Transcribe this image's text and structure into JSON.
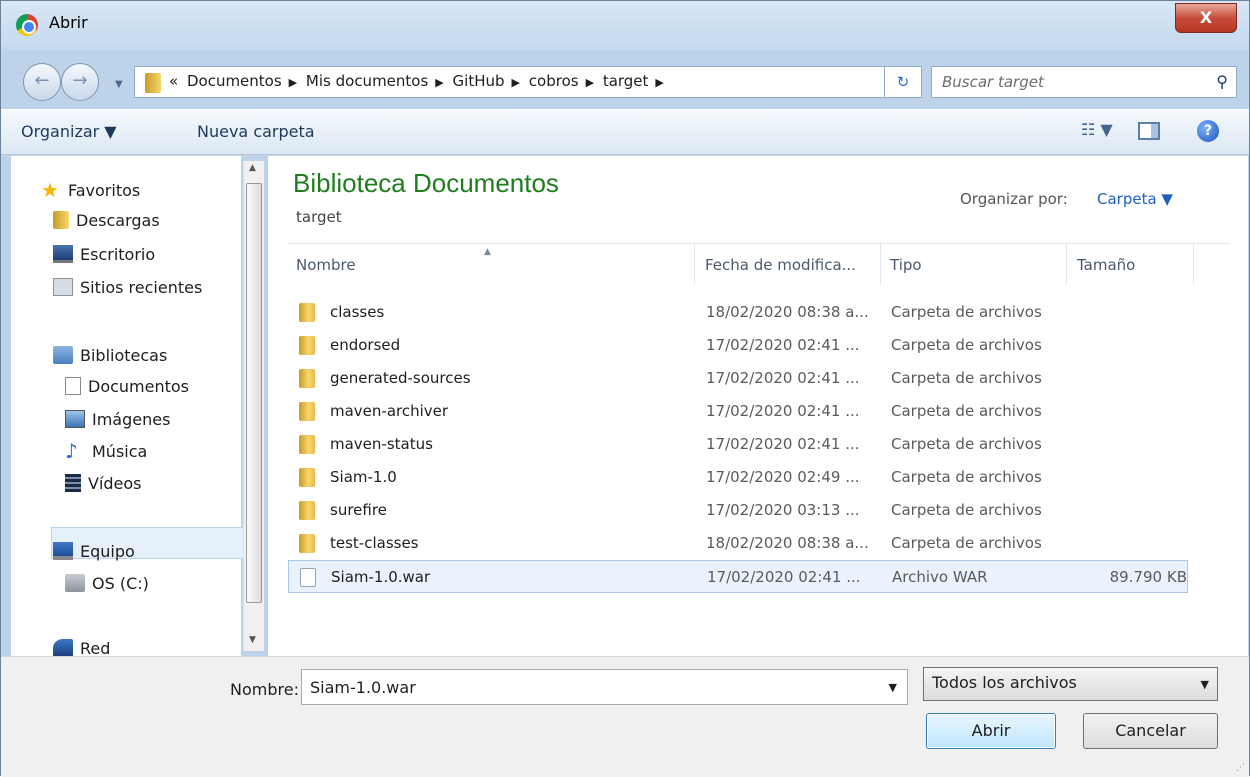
{
  "window": {
    "title": "Abrir",
    "close_label": "X"
  },
  "address": {
    "overflow": "«",
    "crumbs": [
      "Documentos",
      "Mis documentos",
      "GitHub",
      "cobros",
      "target"
    ],
    "separator": "▶",
    "search_placeholder": "Buscar target"
  },
  "toolbar": {
    "organize_label": "Organizar ▼",
    "new_folder_label": "Nueva carpeta",
    "views_label": "☷ ▼",
    "help_label": "?"
  },
  "sidebar": {
    "favorites": {
      "label": "Favoritos",
      "items": [
        "Descargas",
        "Escritorio",
        "Sitios recientes"
      ]
    },
    "libraries": {
      "label": "Bibliotecas",
      "items": [
        "Documentos",
        "Imágenes",
        "Música",
        "Vídeos"
      ]
    },
    "computer": {
      "label": "Equipo",
      "items": [
        "OS (C:)"
      ]
    },
    "network": {
      "label": "Red"
    },
    "selected": "Documentos"
  },
  "content": {
    "library_title": "Biblioteca Documentos",
    "library_subtitle": "target",
    "arrange_label": "Organizar por:",
    "arrange_value": "Carpeta ▼",
    "columns": {
      "name": "Nombre",
      "date": "Fecha de modifica...",
      "type": "Tipo",
      "size": "Tamaño"
    },
    "rows": [
      {
        "name": "classes",
        "date": "18/02/2020 08:38 a...",
        "type": "Carpeta de archivos",
        "size": "",
        "kind": "folder"
      },
      {
        "name": "endorsed",
        "date": "17/02/2020 02:41 ...",
        "type": "Carpeta de archivos",
        "size": "",
        "kind": "folder"
      },
      {
        "name": "generated-sources",
        "date": "17/02/2020 02:41 ...",
        "type": "Carpeta de archivos",
        "size": "",
        "kind": "folder"
      },
      {
        "name": "maven-archiver",
        "date": "17/02/2020 02:41 ...",
        "type": "Carpeta de archivos",
        "size": "",
        "kind": "folder"
      },
      {
        "name": "maven-status",
        "date": "17/02/2020 02:41 ...",
        "type": "Carpeta de archivos",
        "size": "",
        "kind": "folder"
      },
      {
        "name": "Siam-1.0",
        "date": "17/02/2020 02:49 ...",
        "type": "Carpeta de archivos",
        "size": "",
        "kind": "folder"
      },
      {
        "name": "surefire",
        "date": "17/02/2020 03:13 ...",
        "type": "Carpeta de archivos",
        "size": "",
        "kind": "folder"
      },
      {
        "name": "test-classes",
        "date": "18/02/2020 08:38 a...",
        "type": "Carpeta de archivos",
        "size": "",
        "kind": "folder"
      },
      {
        "name": "Siam-1.0.war",
        "date": "17/02/2020 02:41 ...",
        "type": "Archivo WAR",
        "size": "89.790 KB",
        "kind": "file",
        "selected": true
      }
    ]
  },
  "bottom": {
    "filename_label": "Nombre:",
    "filename_value": "Siam-1.0.war",
    "filter_value": "Todos los archivos",
    "open_label": "Abrir",
    "cancel_label": "Cancelar"
  },
  "colors": {
    "title_green": "#1e7e1e",
    "link_blue": "#1e5fbb",
    "selection": "#eaf3fd"
  }
}
